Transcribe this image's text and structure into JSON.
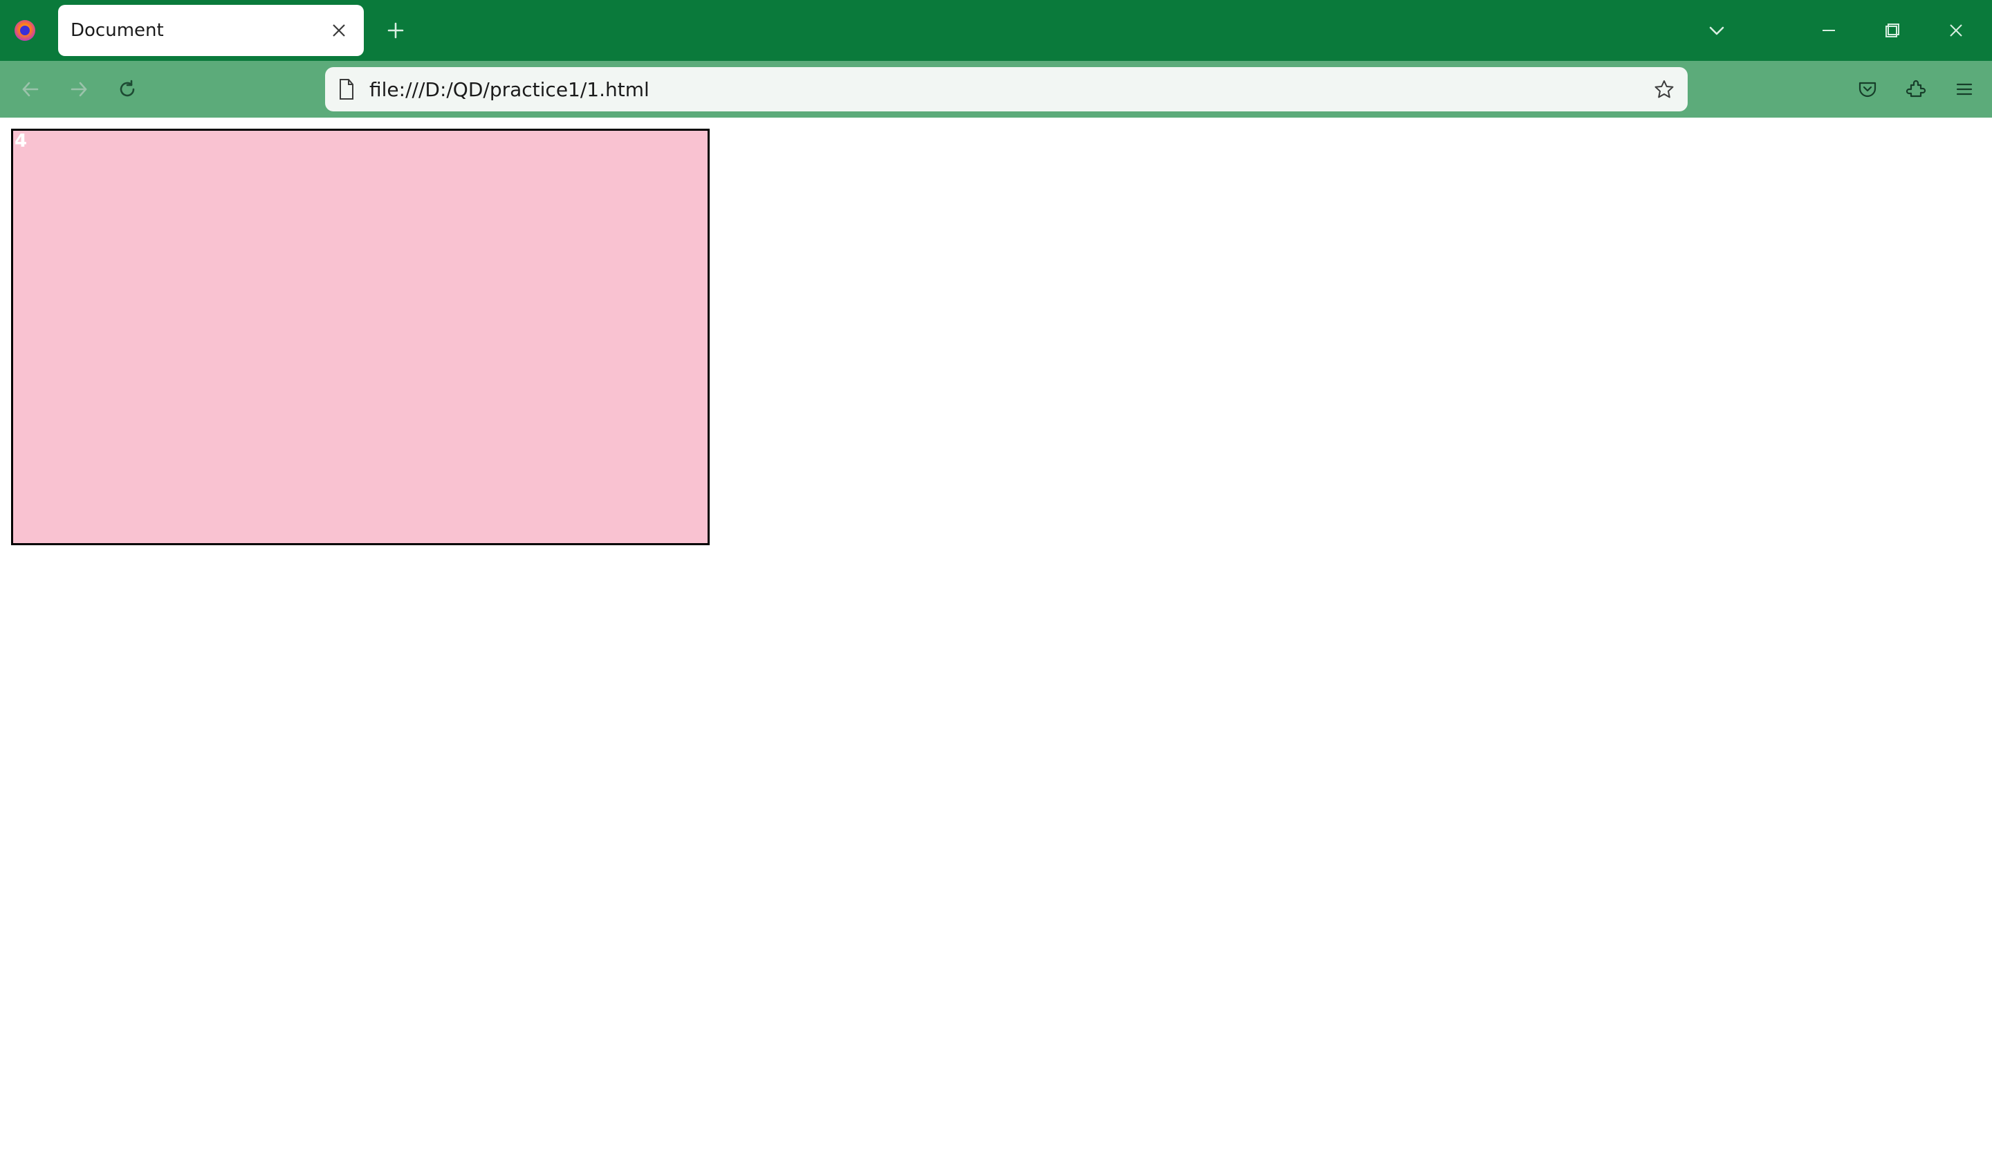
{
  "window": {
    "tabs": [
      {
        "title": "Document"
      }
    ],
    "url": "file:///D:/QD/practice1/1.html"
  },
  "page": {
    "box_text": "4"
  },
  "icons": {
    "firefox": "firefox-logo-icon",
    "close": "close-icon",
    "newtab": "plus-icon",
    "tabs_dropdown": "chevron-down-icon",
    "minimize": "minimize-icon",
    "maximize": "maximize-icon",
    "closewin": "close-window-icon",
    "back": "back-arrow-icon",
    "forward": "forward-arrow-icon",
    "reload": "reload-icon",
    "identity": "file-icon",
    "bookmark": "star-icon",
    "pocket": "pocket-icon",
    "extensions": "puzzle-icon",
    "appmenu": "hamburger-icon"
  }
}
